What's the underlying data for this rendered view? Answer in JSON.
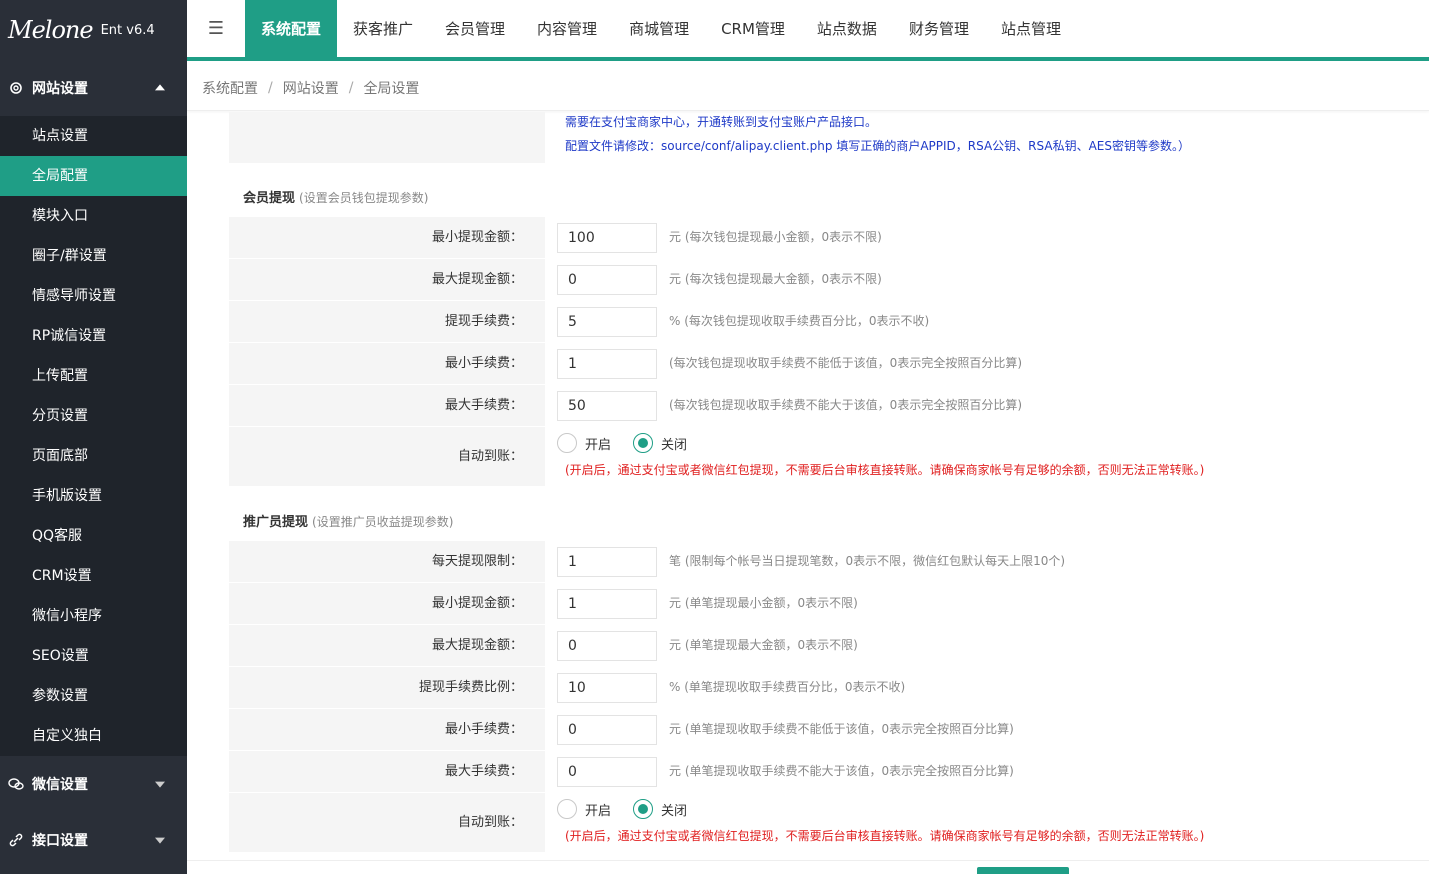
{
  "app": {
    "logo_text": "Melone",
    "version": "Ent v6.4"
  },
  "sidebar": {
    "groups": [
      {
        "label": "网站设置",
        "icon": "gear-icon",
        "expanded": true
      },
      {
        "label": "微信设置",
        "icon": "wechat-icon",
        "expanded": false
      },
      {
        "label": "接口设置",
        "icon": "link-icon",
        "expanded": false
      }
    ],
    "items": [
      {
        "label": "站点设置"
      },
      {
        "label": "全局配置"
      },
      {
        "label": "模块入口"
      },
      {
        "label": "圈子/群设置"
      },
      {
        "label": "情感导师设置"
      },
      {
        "label": "RP诚信设置"
      },
      {
        "label": "上传配置"
      },
      {
        "label": "分页设置"
      },
      {
        "label": "页面底部"
      },
      {
        "label": "手机版设置"
      },
      {
        "label": "QQ客服"
      },
      {
        "label": "CRM设置"
      },
      {
        "label": "微信小程序"
      },
      {
        "label": "SEO设置"
      },
      {
        "label": "参数设置"
      },
      {
        "label": "自定义独白"
      }
    ],
    "active_item": "全局配置"
  },
  "topbar": {
    "tabs": [
      {
        "label": "系统配置"
      },
      {
        "label": "获客推广"
      },
      {
        "label": "会员管理"
      },
      {
        "label": "内容管理"
      },
      {
        "label": "商城管理"
      },
      {
        "label": "CRM管理"
      },
      {
        "label": "站点数据"
      },
      {
        "label": "财务管理"
      },
      {
        "label": "站点管理"
      }
    ],
    "active_tab": "系统配置"
  },
  "breadcrumb": {
    "items": [
      "系统配置",
      "网站设置",
      "全局设置"
    ],
    "separator": "/"
  },
  "top_notes": {
    "line1": "需要在支付宝商家中心，开通转账到支付宝账户产品接口。",
    "line2": "配置文件请修改：source/conf/alipay.client.php 填写正确的商户APPID，RSA公钥、RSA私钥、AES密钥等参数。）"
  },
  "member_withdraw": {
    "title": "会员提现",
    "hint": "(设置会员钱包提现参数)",
    "rows": [
      {
        "label": "最小提现金额：",
        "value": "100",
        "hint": "元 (每次钱包提现最小金额，0表示不限)"
      },
      {
        "label": "最大提现金额：",
        "value": "0",
        "hint": "元 (每次钱包提现最大金额，0表示不限)"
      },
      {
        "label": "提现手续费：",
        "value": "5",
        "hint": "% (每次钱包提现收取手续费百分比，0表示不收)"
      },
      {
        "label": "最小手续费：",
        "value": "1",
        "hint": "(每次钱包提现收取手续费不能低于该值，0表示完全按照百分比算)"
      },
      {
        "label": "最大手续费：",
        "value": "50",
        "hint": "(每次钱包提现收取手续费不能大于该值，0表示完全按照百分比算)"
      }
    ],
    "auto": {
      "label": "自动到账：",
      "options": [
        "开启",
        "关闭"
      ],
      "selected": "关闭",
      "warning": "(开启后，通过支付宝或者微信红包提现，不需要后台审核直接转账。请确保商家帐号有足够的余额，否则无法正常转账。)"
    }
  },
  "promoter_withdraw": {
    "title": "推广员提现",
    "hint": "(设置推广员收益提现参数)",
    "rows": [
      {
        "label": "每天提现限制：",
        "value": "1",
        "hint": "笔 (限制每个帐号当日提现笔数，0表示不限，微信红包默认每天上限10个)"
      },
      {
        "label": "最小提现金额：",
        "value": "1",
        "hint": "元 (单笔提现最小金额，0表示不限)"
      },
      {
        "label": "最大提现金额：",
        "value": "0",
        "hint": "元 (单笔提现最大金额，0表示不限)"
      },
      {
        "label": "提现手续费比例：",
        "value": "10",
        "hint": "% (单笔提现收取手续费百分比，0表示不收)"
      },
      {
        "label": "最小手续费：",
        "value": "0",
        "hint": "元 (单笔提现收取手续费不能低于该值，0表示完全按照百分比算)"
      },
      {
        "label": "最大手续费：",
        "value": "0",
        "hint": "元 (单笔提现收取手续费不能大于该值，0表示完全按照百分比算)"
      }
    ],
    "auto": {
      "label": "自动到账：",
      "options": [
        "开启",
        "关闭"
      ],
      "selected": "关闭",
      "warning": "(开启后，通过支付宝或者微信红包提现，不需要后台审核直接转账。请确保商家帐号有足够的余额，否则无法正常转账。)"
    }
  },
  "colors": {
    "accent": "#1f9e86",
    "sidebar_bg": "#2a2f38",
    "warning": "#e02020",
    "note_blue": "#1e39c7"
  }
}
